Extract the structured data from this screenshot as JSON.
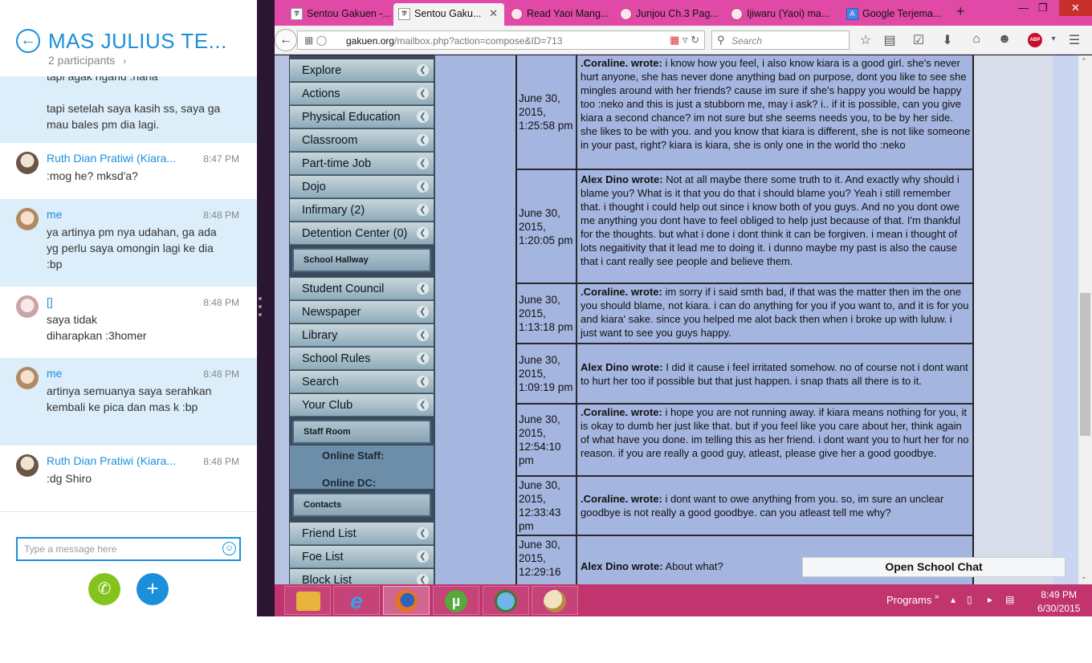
{
  "skype": {
    "title": "MAS JULIUS TE...",
    "participants": "2 participants",
    "messages": [
      {
        "sender": "",
        "time": "",
        "lines": [
          "tapi agak nganu :haha",
          "",
          "tapi setelah saya kasih ss, saya ga mau bales pm dia lagi."
        ],
        "mine": true,
        "avatar": "none"
      },
      {
        "sender": "Ruth Dian Pratiwi (Kiara...",
        "time": "8:47 PM",
        "lines": [
          ":mog he? mksd'a?"
        ],
        "mine": false,
        "avatar": "ruth"
      },
      {
        "sender": "me",
        "time": "8:48 PM",
        "lines": [
          "ya artinya pm nya udahan, ga ada yg perlu saya omongin lagi ke dia :bp"
        ],
        "mine": true,
        "avatar": "me"
      },
      {
        "sender": "[]",
        "time": "8:48 PM",
        "lines": [
          "saya tidak",
          "diharapkan :3homer"
        ],
        "mine": false,
        "avatar": "pink"
      },
      {
        "sender": "me",
        "time": "8:48 PM",
        "lines": [
          "artinya semuanya saya serahkan kembali ke pica dan mas k :bp"
        ],
        "mine": true,
        "avatar": "me"
      },
      {
        "sender": "Ruth Dian Pratiwi (Kiara...",
        "time": "8:48 PM",
        "lines": [
          ":dg Shiro"
        ],
        "mine": false,
        "avatar": "ruth"
      }
    ],
    "input_placeholder": "Type a message here"
  },
  "browser": {
    "tabs": [
      {
        "label": "Sentou Gakuen -...",
        "icon": "gakuen-favicon"
      },
      {
        "label": "Sentou Gaku...",
        "icon": "gakuen-favicon",
        "active": true
      },
      {
        "label": "Read Yaoi Mang...",
        "icon": "manga-favicon"
      },
      {
        "label": "Junjou Ch.3 Pag...",
        "icon": "manga-favicon"
      },
      {
        "label": "Ijiwaru (Yaoi) ma...",
        "icon": "manga-favicon"
      },
      {
        "label": "Google Terjema...",
        "icon": "google-translate-favicon"
      }
    ],
    "url_host": "gakuen.org",
    "url_path": "/mailbox.php?action=compose&ID=713",
    "search_placeholder": "Search",
    "abp_label": "ABP"
  },
  "sidebar": {
    "group1": [
      "Explore",
      "Actions",
      "Physical Education",
      "Classroom",
      "Part-time Job",
      "Dojo",
      "Infirmary (2)",
      "Detention Center (0)"
    ],
    "hall_title": "School Hallway",
    "group2": [
      "Student Council",
      "Newspaper",
      "Library",
      "School Rules",
      "Search",
      "Your Club"
    ],
    "staff_title": "Staff Room",
    "online_staff": "Online Staff:",
    "online_dc": "Online DC:",
    "contacts_title": "Contacts",
    "group3": [
      "Friend List",
      "Foe List",
      "Block List"
    ]
  },
  "mail": {
    "rows": [
      {
        "date": "June 30, 2015, 1:25:58 pm",
        "author": ".Coraline. wrote:",
        "text": " i know how you feel, i also know kiara is a good girl. she's never hurt anyone, she has never done anything bad on purpose, dont you like to see she mingles around with her friends? cause im sure if she's happy you would be happy too :neko and this is just a stubborn me, may i ask? i.. if it is possible, can you give kiara a second chance? im not sure but she seems needs you, to be by her side. she likes to be with you. and you know that kiara is different, she is not like someone in your past, right? kiara is kiara, she is only one in the world tho :neko"
      },
      {
        "date": "June 30, 2015, 1:20:05 pm",
        "author": "Alex Dino wrote:",
        "text": " Not at all maybe there some truth to it. And exactly why should i blame you? What is it that you do that i should blame you? Yeah i still remember that. i thought i could help out since i know both of you guys. And no you dont owe me anything you dont have to feel obliged to help just because of that. I'm thankful for the thoughts. but what i done i dont think it can be forgiven. i mean i thought of lots negaitivity that it lead me to doing it. i dunno maybe my past is also the cause that i cant really see people and believe them."
      },
      {
        "date": "June 30, 2015, 1:13:18 pm",
        "author": ".Coraline. wrote:",
        "text": " im sorry if i said smth bad, if that was the matter then im the one you should blame, not kiara. i can do anything for you if you want to, and it is for you and kiara' sake. since you helped me alot back then when i broke up with luluw. i just want to see you guys happy."
      },
      {
        "date": "June 30, 2015, 1:09:19 pm",
        "author": "Alex Dino wrote:",
        "text": " I did it cause i feel irritated somehow. no of course not i dont want to hurt her too if possible but that just happen. i snap thats all there is to it."
      },
      {
        "date": "June 30, 2015, 12:54:10 pm",
        "author": ".Coraline. wrote:",
        "text": " i hope you are not running away. if kiara means nothing for you, it is okay to dumb her just like that. but if you feel like you care about her, think again of what have you done. im telling this as her friend. i dont want you to hurt her for no reason. if you are really a good guy, atleast, please give her a good goodbye."
      },
      {
        "date": "June 30, 2015, 12:33:43 pm",
        "author": ".Coraline. wrote:",
        "text": " i dont want to owe anything from you. so, im sure an unclear goodbye is not really a good goodbye. can you atleast tell me why?"
      },
      {
        "date": "June 30, 2015, 12:29:16",
        "author": "Alex Dino wrote:",
        "text": " About what?"
      }
    ]
  },
  "chat_button": "Open School Chat",
  "taskbar": {
    "programs": "Programs",
    "time": "8:49 PM",
    "date": "6/30/2015"
  }
}
